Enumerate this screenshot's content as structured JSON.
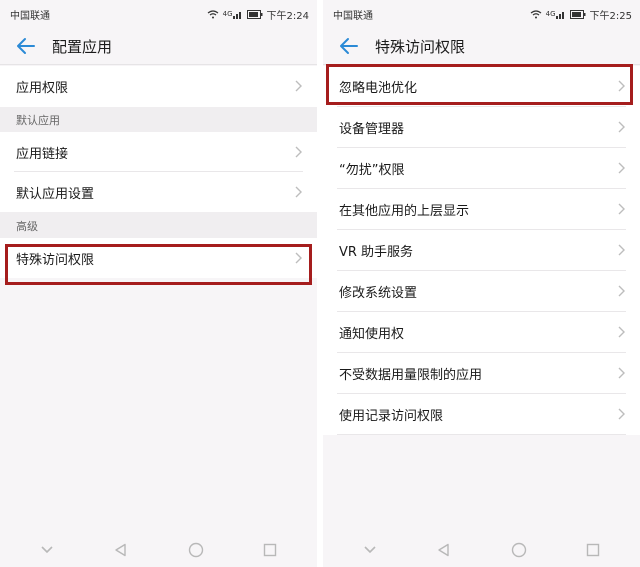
{
  "left": {
    "status": {
      "carrier": "中国联通",
      "signal_text": "4G",
      "time": "下午2:24"
    },
    "title": "配置应用",
    "rows": [
      {
        "label": "应用权限"
      }
    ],
    "section1": "默认应用",
    "rows2": [
      {
        "label": "应用链接"
      },
      {
        "label": "默认应用设置"
      }
    ],
    "section2": "高级",
    "rows3": [
      {
        "label": "特殊访问权限"
      }
    ]
  },
  "right": {
    "status": {
      "carrier": "中国联通",
      "signal_text": "4G",
      "time": "下午2:25"
    },
    "title": "特殊访问权限",
    "rows": [
      {
        "label": "忽略电池优化"
      },
      {
        "label": "设备管理器"
      },
      {
        "label": "“勿扰”权限"
      },
      {
        "label": "在其他应用的上层显示"
      },
      {
        "label": "VR 助手服务"
      },
      {
        "label": "修改系统设置"
      },
      {
        "label": "通知使用权"
      },
      {
        "label": "不受数据用量限制的应用"
      },
      {
        "label": "使用记录访问权限"
      }
    ]
  },
  "colors": {
    "accent": "#2b8ad6",
    "highlight": "#a51d1d",
    "background": "#f7f5f7"
  },
  "icons": {
    "back": "arrow-left-icon",
    "chevron": "chevron-right-icon",
    "wifi": "wifi-icon",
    "signal": "signal-icon",
    "battery": "battery-icon",
    "nav": [
      "nav-down-icon",
      "nav-back-icon",
      "nav-home-icon",
      "nav-recent-icon"
    ]
  }
}
